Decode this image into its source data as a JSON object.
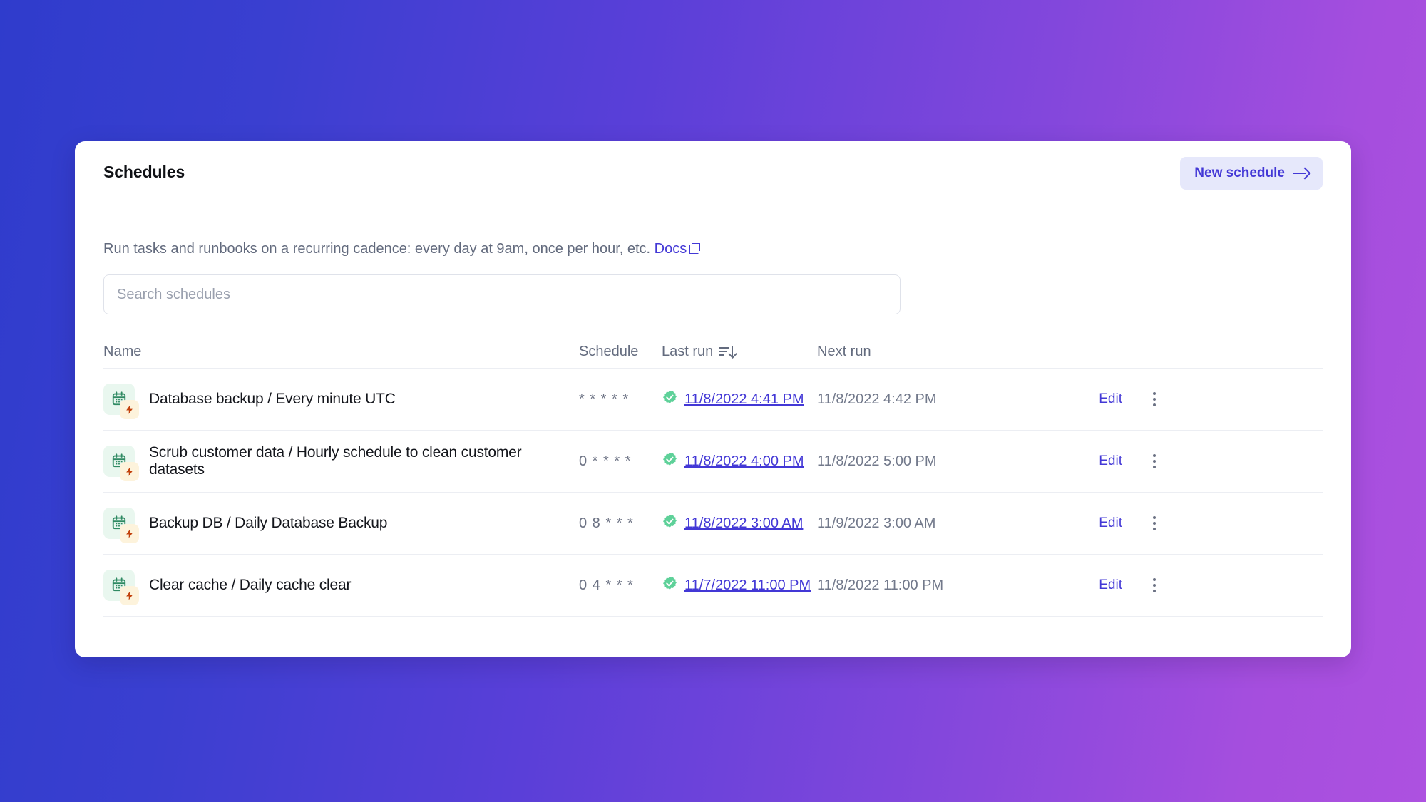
{
  "header": {
    "title": "Schedules",
    "new_schedule_label": "New schedule"
  },
  "description": {
    "text": "Run tasks and runbooks on a recurring cadence: every day at 9am, once per hour, etc.",
    "docs_label": "Docs"
  },
  "search": {
    "placeholder": "Search schedules",
    "value": ""
  },
  "table": {
    "columns": {
      "name": "Name",
      "schedule": "Schedule",
      "last_run": "Last run",
      "next_run": "Next run"
    },
    "sort": {
      "column": "Last run",
      "direction": "desc"
    },
    "row_action_label": "Edit",
    "rows": [
      {
        "name": "Database backup / Every minute UTC",
        "cron": "* * * * *",
        "last_run": "11/8/2022 4:41 PM",
        "last_run_status": "success",
        "next_run": "11/8/2022 4:42 PM",
        "edit": "Edit"
      },
      {
        "name": "Scrub customer data / Hourly schedule to clean customer datasets",
        "cron": "0 * * * *",
        "last_run": "11/8/2022 4:00 PM",
        "last_run_status": "success",
        "next_run": "11/8/2022 5:00 PM",
        "edit": "Edit"
      },
      {
        "name": "Backup DB / Daily Database Backup",
        "cron": "0 8 * * *",
        "last_run": "11/8/2022 3:00 AM",
        "last_run_status": "success",
        "next_run": "11/9/2022 3:00 AM",
        "edit": "Edit"
      },
      {
        "name": "Clear cache / Daily cache clear",
        "cron": "0 4 * * *",
        "last_run": "11/7/2022 11:00 PM",
        "last_run_status": "success",
        "next_run": "11/8/2022 11:00 PM",
        "edit": "Edit"
      }
    ]
  },
  "icons": {
    "new_schedule": "arrow-right-icon",
    "docs": "external-link-icon",
    "sort": "sort-descending-icon",
    "row_type": "calendar-icon",
    "row_badge": "lightning-bolt-icon",
    "status": "check-badge-icon",
    "menu": "more-vertical-icon"
  },
  "colors": {
    "accent": "#4338d6",
    "accent_soft": "#e6e8fb",
    "success": "#5ed199",
    "icon_tile": "#e9f7ef",
    "badge_tile": "#fdf3dc",
    "bg_gradient_start": "#2f3ccc",
    "bg_gradient_end": "#ad51e0"
  }
}
